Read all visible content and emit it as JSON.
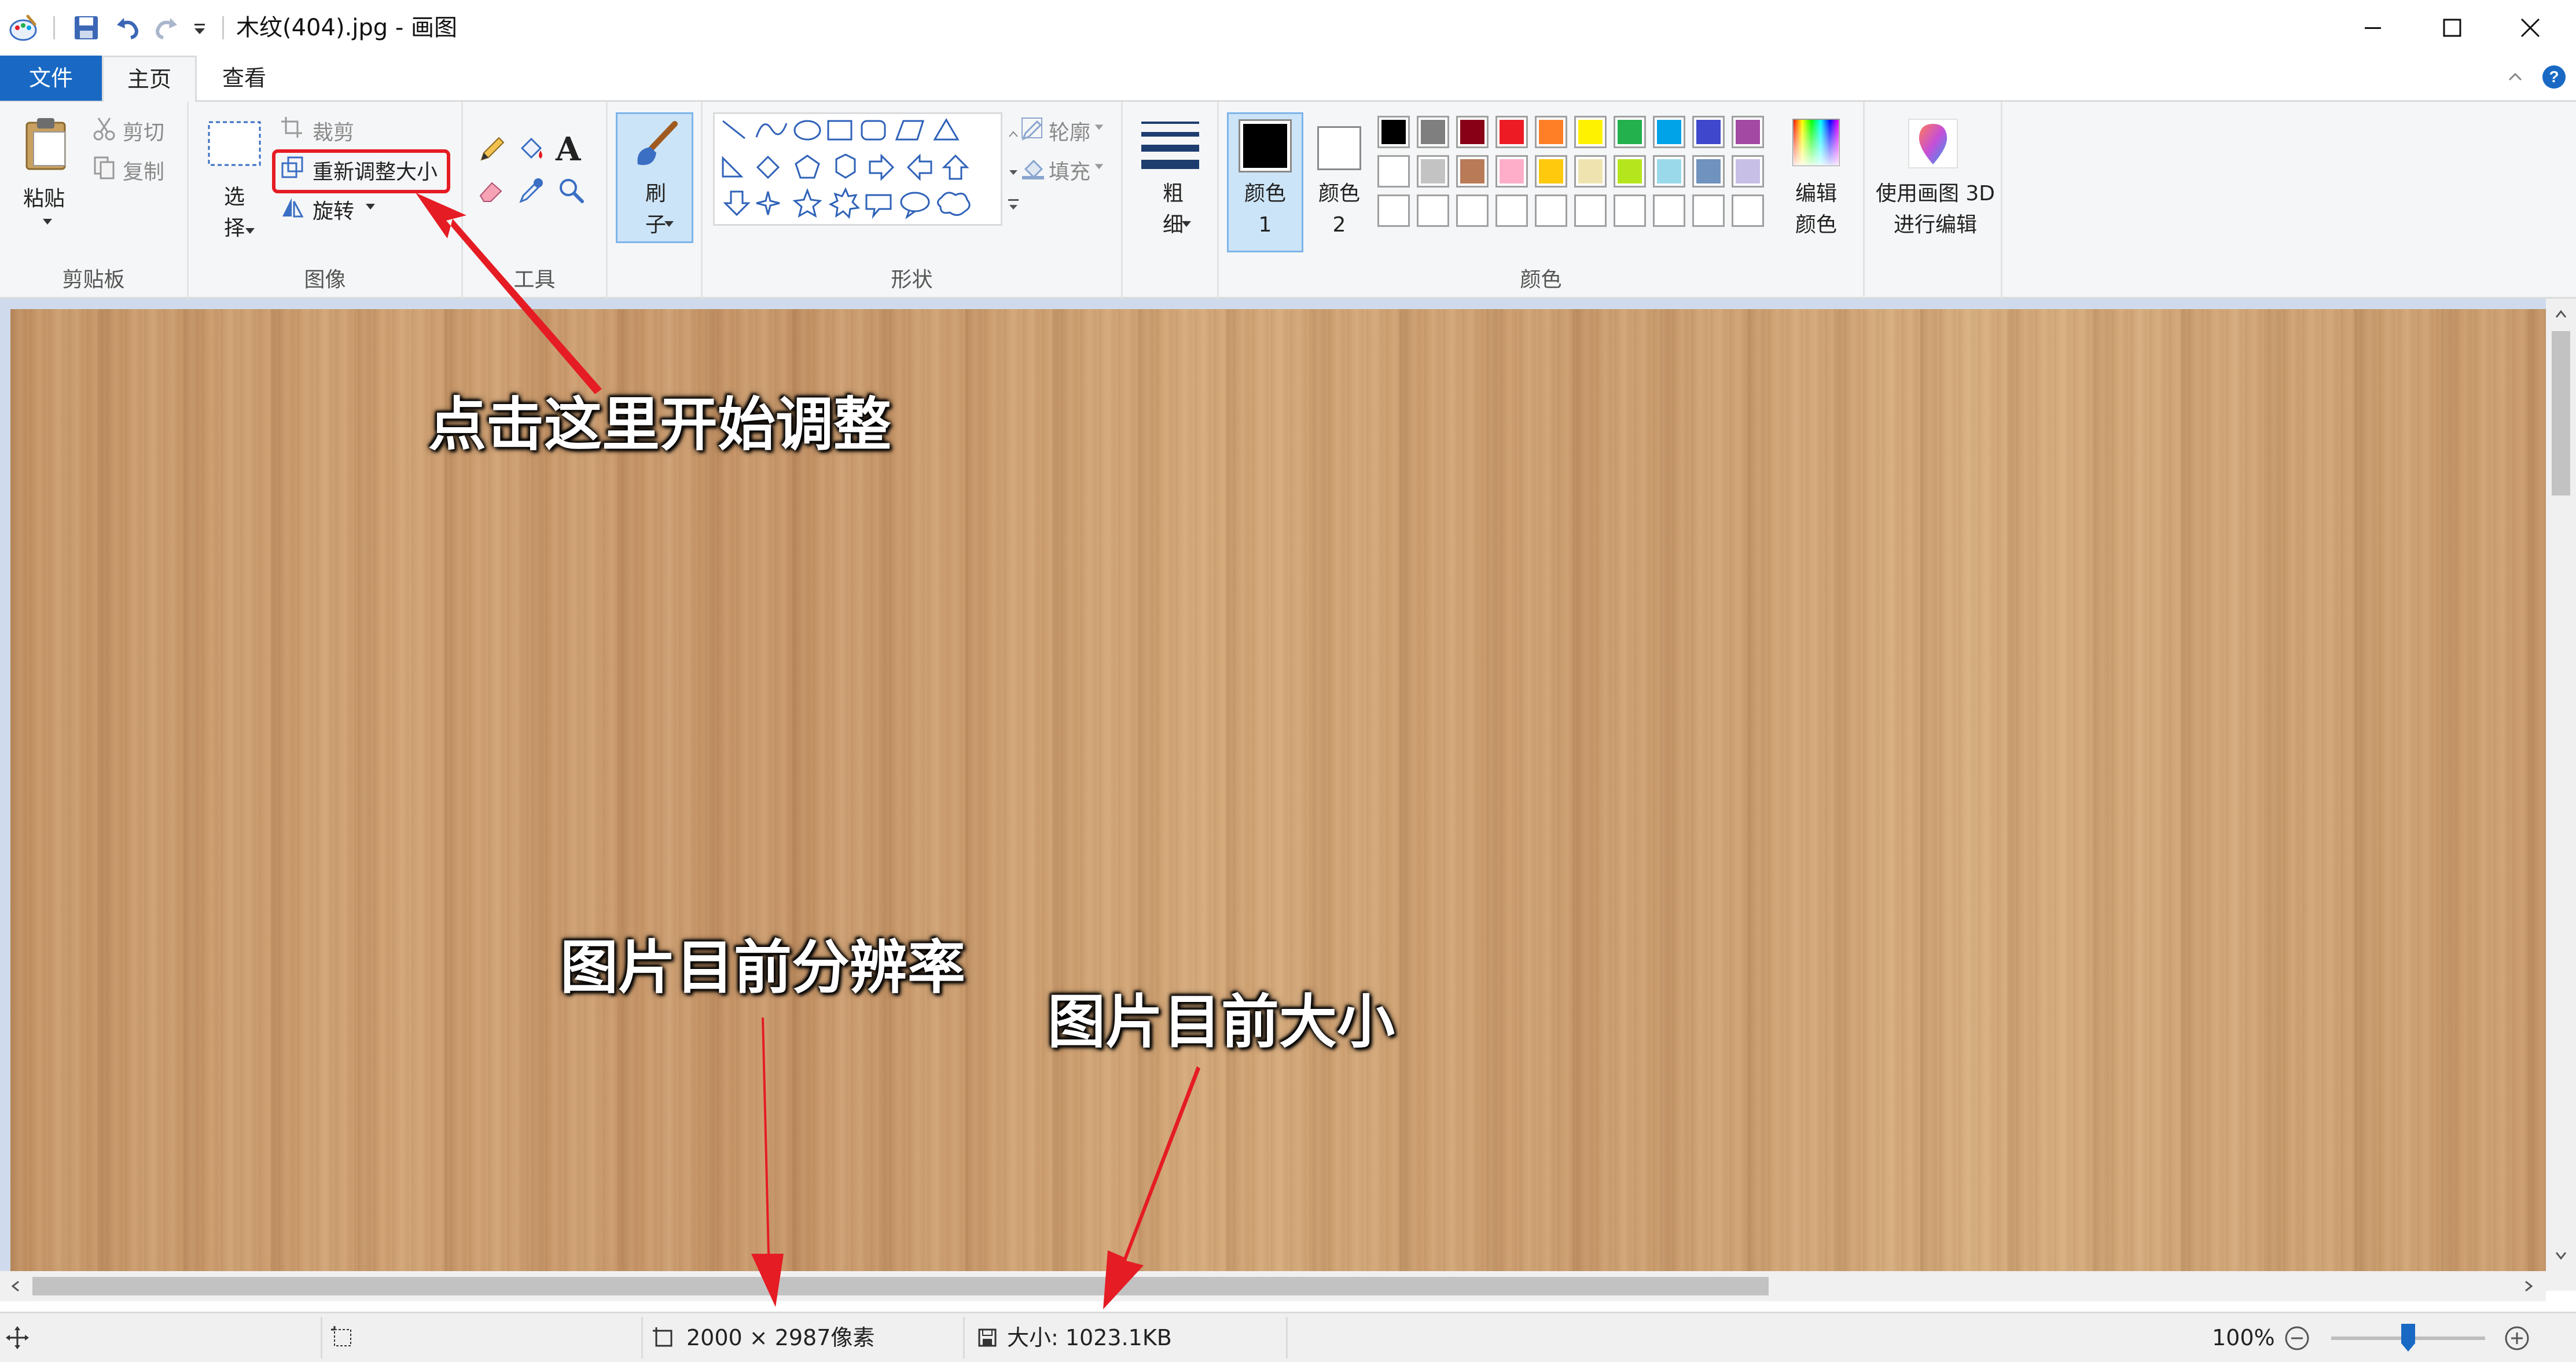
{
  "window": {
    "title": "木纹(404).jpg - 画图"
  },
  "tabs": {
    "file": "文件",
    "home": "主页",
    "view": "查看"
  },
  "ribbon": {
    "clipboard": {
      "group_label": "剪贴板",
      "paste": "粘贴",
      "cut": "剪切",
      "copy": "复制"
    },
    "image": {
      "group_label": "图像",
      "select": "选择",
      "crop": "裁剪",
      "resize": "重新调整大小",
      "rotate": "旋转"
    },
    "tools": {
      "group_label": "工具",
      "text_glyph": "A"
    },
    "brushes": {
      "label": "刷子"
    },
    "shapes": {
      "group_label": "形状",
      "outline": "轮廓",
      "fill": "填充"
    },
    "size": {
      "label": "粗细"
    },
    "colors": {
      "group_label": "颜色",
      "color1_label": "颜色 1",
      "color2_label": "颜色 2",
      "color1": "#000000",
      "color2": "#ffffff",
      "edit_colors": "编辑颜色",
      "palette_row1": [
        "#000000",
        "#7f7f7f",
        "#880015",
        "#ed1c24",
        "#ff7f27",
        "#fff200",
        "#22b14c",
        "#00a2e8",
        "#3f48cc",
        "#a349a4"
      ],
      "palette_row2": [
        "#ffffff",
        "#c3c3c3",
        "#b97a57",
        "#ffaec9",
        "#ffc90e",
        "#efe4b0",
        "#b5e61d",
        "#99d9ea",
        "#7092be",
        "#c8bfe7"
      ]
    },
    "paint3d": {
      "label": "使用画图 3D 进行编辑"
    }
  },
  "statusbar": {
    "dimensions": "2000 × 2987像素",
    "size": "大小: 1023.1KB",
    "zoom": "100%",
    "zoom_slider_fraction": 0.5
  },
  "annotations": {
    "click_here": "点击这里开始调整",
    "resolution": "图片目前分辨率",
    "file_size": "图片目前大小"
  },
  "accent": "#1969c4",
  "highlight": "#e51c23"
}
